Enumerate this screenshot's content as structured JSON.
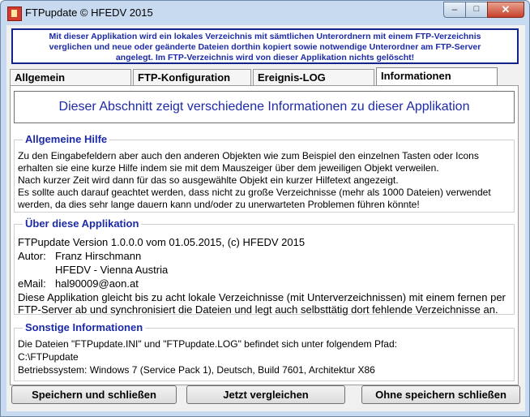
{
  "window": {
    "title": "FTPupdate © HFEDV 2015",
    "minimize": "–",
    "maximize": "□",
    "close": "✕"
  },
  "banner": {
    "line1": "Mit dieser Applikation wird ein lokales Verzeichnis mit sämtlichen Unterordnern mit einem FTP-Verzeichnis",
    "line2": "verglichen und neue oder geänderte Dateien dorthin kopiert sowie notwendige Unterordner am FTP-Server",
    "line3": "angelegt. Im FTP-Verzeichnis wird von dieser Applikation nichts gelöscht!"
  },
  "tabs": [
    {
      "label": "Allgemein"
    },
    {
      "label": "FTP-Konfiguration"
    },
    {
      "label": "Ereignis-LOG"
    },
    {
      "label": "Informationen"
    }
  ],
  "headline": "Dieser Abschnitt zeigt verschiedene Informationen zu dieser Applikation",
  "help": {
    "title": "Allgemeine Hilfe",
    "lines": [
      "Zu den Eingabefeldern aber auch den anderen Objekten wie zum Beispiel den einzelnen Tasten oder Icons",
      "erhalten sie eine kurze Hilfe indem sie mit dem Mauszeiger über dem jeweiligen Objekt verweilen.",
      "Nach kurzer Zeit wird dann für das so ausgewählte Objekt ein kurzer Hilfetext angezeigt.",
      "Es sollte auch darauf geachtet werden, dass nicht zu große Verzeichnisse (mehr als 1000 Dateien) verwendet",
      "werden, da dies sehr lange dauern kann und/oder zu unerwarteten Problemen führen könnte!"
    ]
  },
  "about": {
    "title": "Über diese Applikation",
    "version": "FTPupdate Version 1.0.0.0  vom 01.05.2015, (c) HFEDV 2015",
    "author_label": "Autor:",
    "author_name": "Franz Hirschmann",
    "author_org": "HFEDV - Vienna Austria",
    "email_label": "eMail:",
    "email": "hal90009@aon.at",
    "desc1": "Diese Applikation gleicht bis zu acht lokale Verzeichnisse (mit Unterverzeichnissen) mit einem fernen per",
    "desc2": "FTP-Server ab und synchronisiert die Dateien und legt auch selbsttätig dort fehlende Verzeichnisse an."
  },
  "other": {
    "title": "Sonstige Informationen",
    "line1": "Die Dateien \"FTPupdate.INI\" und \"FTPupdate.LOG\" befindet sich unter folgendem Pfad:",
    "line2": "C:\\FTPupdate",
    "line3": "Betriebssystem: Windows 7 (Service Pack 1), Deutsch, Build 7601, Architektur X86"
  },
  "buttons": {
    "save_close": "Speichern und schließen",
    "compare": "Jetzt vergleichen",
    "close_nosave": "Ohne speichern schließen"
  }
}
